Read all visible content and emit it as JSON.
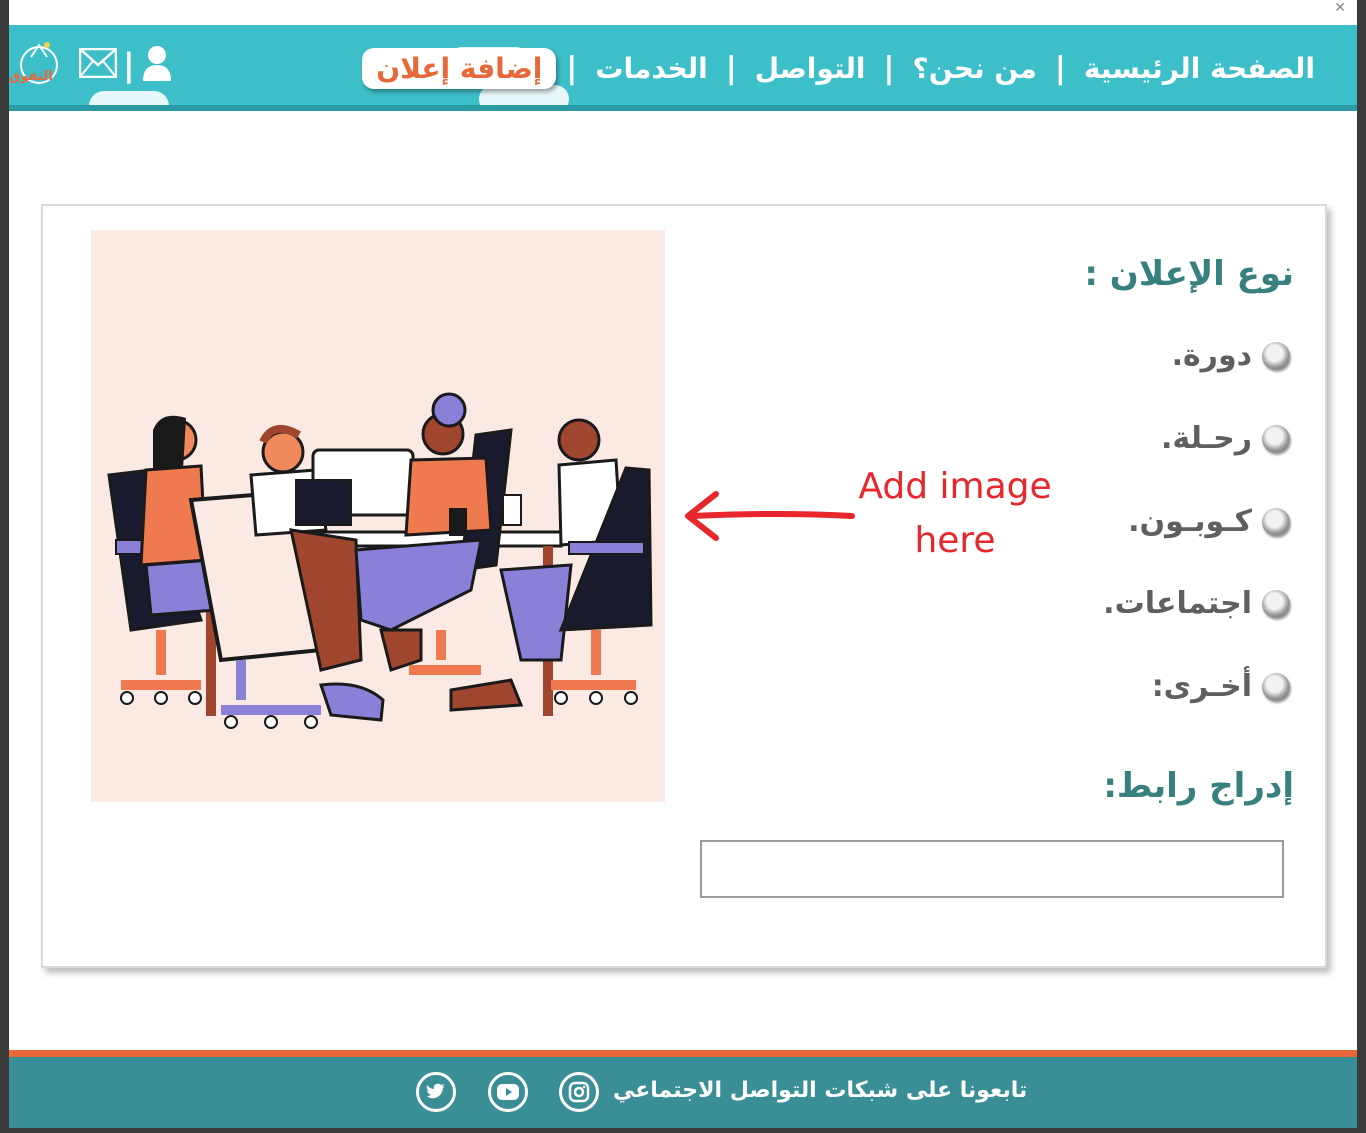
{
  "header": {
    "nav": [
      {
        "label": "الصفحة الرئيسية"
      },
      {
        "label": "من نحن؟"
      },
      {
        "label": "التواصل"
      },
      {
        "label": "الخدمات"
      },
      {
        "label": "إضافة إعلان",
        "active": true
      }
    ],
    "logo_text": "التفوق",
    "icons": [
      "envelope-icon",
      "user-icon"
    ],
    "colors": {
      "bar": "#3dbfc9",
      "accent": "#e8683a"
    }
  },
  "form": {
    "ad_type_title": "نوع الإعلان :",
    "options": [
      {
        "label": "دورة."
      },
      {
        "label": "رحـلة."
      },
      {
        "label": "كـوبـون."
      },
      {
        "label": "اجتماعات."
      },
      {
        "label": "أخـرى:"
      }
    ],
    "link_title": "إدراج رابط:",
    "link_value": ""
  },
  "annotation": {
    "line1": "Add image",
    "line2": "here",
    "color": "#e8262b"
  },
  "footer": {
    "follow_text": "تابعونا على شبكات التواصل الاجتماعي",
    "social": [
      "instagram-icon",
      "youtube-icon",
      "twitter-icon"
    ],
    "colors": {
      "bar": "#3a8f96",
      "stripe": "#e8683a"
    }
  }
}
